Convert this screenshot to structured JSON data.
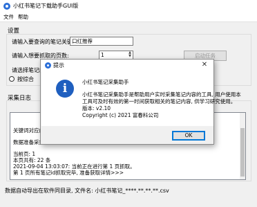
{
  "window": {
    "title": "小红书笔记下载助手GUI版",
    "icon": "app-icon"
  },
  "menu": {
    "items": [
      "文件",
      "帮助"
    ]
  },
  "settings": {
    "section_label": "设置",
    "keyword_label": "请输入要查询的笔记关键词:",
    "keyword_value": "口红推荐",
    "pages_label": "请输入想要抓取的页数:",
    "pages_value": "1",
    "sort_label": "请选择笔记的排",
    "radio_label": "按综合",
    "start_button": "启动任务"
  },
  "log": {
    "section_label": "采集日志",
    "lines": [
      "关键词对应的笔",
      "数据准备采集...",
      "当前页: 1",
      "本页共有: 22 条",
      "2021-09-04 13:03:07: 当前正在进行第 1 页抓取。",
      "第 1 页所有笔记id抓取完毕, 准备获取详情>>>"
    ]
  },
  "status_bar": "数据自动导出在软件同目录, 文件名: 小红书笔记_****.**.**.**.csv",
  "dialog": {
    "title": "提示",
    "close_glyph": "✕",
    "info_glyph": "i",
    "heading": "小红书笔记采集助手",
    "lines": [
      "小红书笔记采集助手是帮助用户实时采集笔记内容的工具, 用户使用本",
      "工具可及时有效的第一时间获取相关的笔记内容, 供学习研究使用。",
      "版本: v2.10",
      "Copyright (c) 2021 富春科公司"
    ],
    "ok_button": "OK"
  },
  "colors": {
    "accent": "#0078d7",
    "info_icon": "#1f5fbf"
  }
}
